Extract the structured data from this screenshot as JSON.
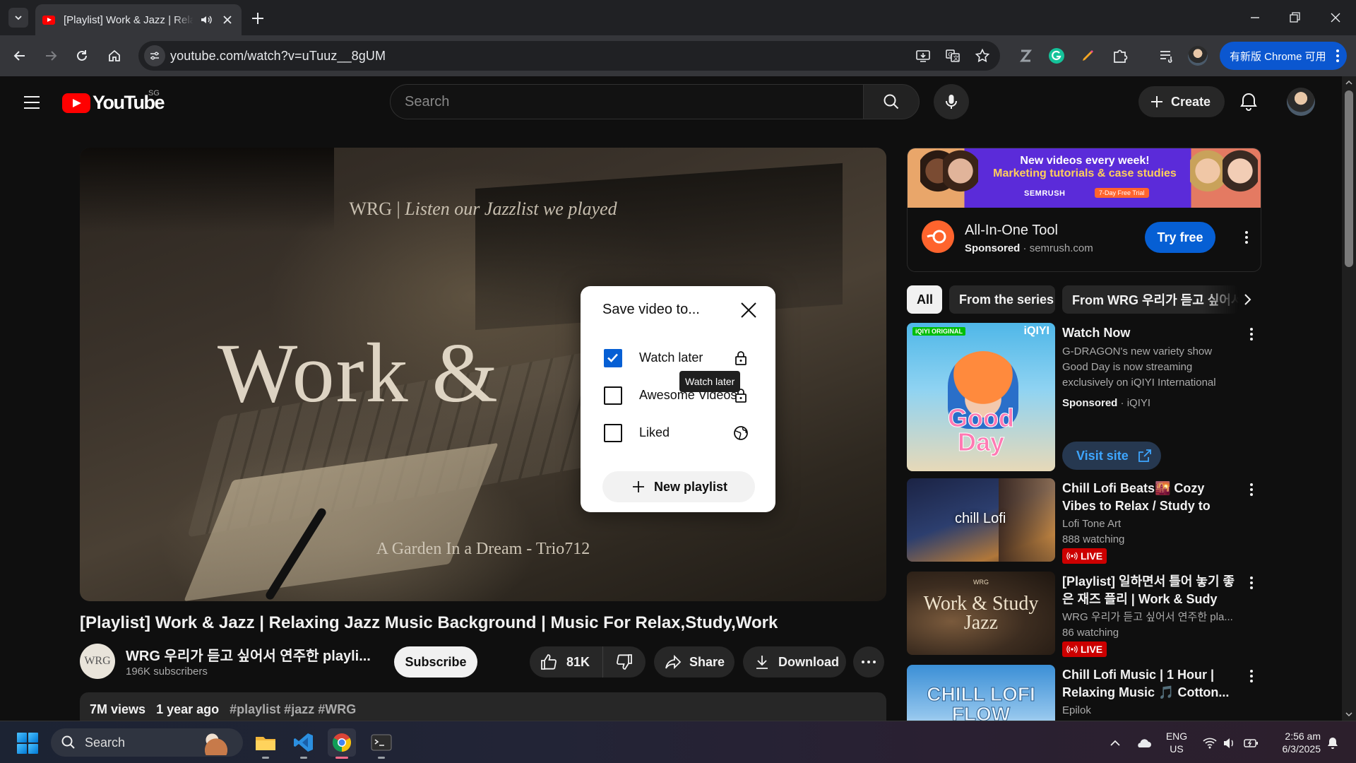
{
  "browser": {
    "tab_title": "[Playlist] Work & Jazz | Relaxing Jazz Music Background | Music For Relax,Study,Work - YouTube",
    "url": "youtube.com/watch?v=uTuuz__8gUM",
    "update_button": "有新版 Chrome 可用"
  },
  "masthead": {
    "logo_text": "YouTube",
    "region": "SG",
    "search_placeholder": "Search",
    "create_label": "Create"
  },
  "player": {
    "overlay_subtitle_brand": "WRG |",
    "overlay_subtitle_text": "Listen our Jazzlist we played",
    "overlay_big_text": "Work &",
    "overlay_credit": "A Garden In a Dream - Trio712"
  },
  "video": {
    "title": "[Playlist] Work & Jazz | Relaxing Jazz Music Background | Music For Relax,Study,Work",
    "channel_avatar_text": "WRG",
    "channel_name": "WRG 우리가 듣고 싶어서 연주한 playli...",
    "subscribers": "196K subscribers",
    "subscribe_label": "Subscribe",
    "likes": "81K",
    "share_label": "Share",
    "download_label": "Download",
    "views": "7M views",
    "age": "1 year ago",
    "hashtags": "#playlist #jazz #WRG"
  },
  "ad": {
    "banner_line1": "New videos every week!",
    "banner_line2": "Marketing tutorials & case studies",
    "banner_brand": "SEMRUSH",
    "banner_trial": "7-Day Free Trial",
    "title": "All-In-One Tool",
    "sponsored": "Sponsored",
    "domain": "semrush.com",
    "cta": "Try free"
  },
  "chips": [
    "All",
    "From the series",
    "From WRG 우리가 듣고 싶어서"
  ],
  "recommendations": [
    {
      "title": "Watch Now",
      "description": "G-DRAGON's new variety show Good Day is now streaming exclusively on iQIYI International",
      "sponsored": "Sponsored",
      "advertiser": "iQIYI",
      "cta": "Visit site",
      "thumb_badge": "iQIYI ORIGINAL",
      "thumb_brand": "iQIYI",
      "thumb_text": "Good Day"
    },
    {
      "title": "Chill Lofi Beats🌇 Cozy Vibes to Relax / Study to",
      "channel": "Lofi Tone Art",
      "stats": "888 watching",
      "live": "LIVE",
      "thumb_text": "chill Lofi"
    },
    {
      "title": "[Playlist] 일하면서 틀어 놓기 좋은 재즈 플리 | Work & Sudy Ja...",
      "channel": "WRG 우리가 듣고 싶어서 연주한 pla...",
      "stats": "86 watching",
      "live": "LIVE",
      "thumb_text": "Work & Study Jazz",
      "thumb_brand": "WRG"
    },
    {
      "title": "Chill Lofi Music | 1 Hour | Relaxing Music 🎵 Cotton...",
      "channel": "Epilok",
      "thumb_text": "CHILL LOFI FLOW"
    }
  ],
  "save_dialog": {
    "title": "Save video to...",
    "playlists": [
      {
        "label": "Watch later",
        "checked": true,
        "privacy": "lock-icon"
      },
      {
        "label": "Awesome Videos",
        "checked": false,
        "privacy": "lock-icon"
      },
      {
        "label": "Liked",
        "checked": false,
        "privacy": "globe-icon"
      }
    ],
    "new_playlist_label": "New playlist",
    "tooltip": "Watch later"
  },
  "taskbar": {
    "search_label": "Search",
    "lang_line1": "ENG",
    "lang_line2": "US",
    "time": "2:56 am",
    "date": "6/3/2025"
  },
  "colors": {
    "youtube_red": "#ff0000",
    "checkbox_blue": "#065fd4",
    "chrome_update_blue": "#0b57d0",
    "live_red": "#cc0000"
  }
}
